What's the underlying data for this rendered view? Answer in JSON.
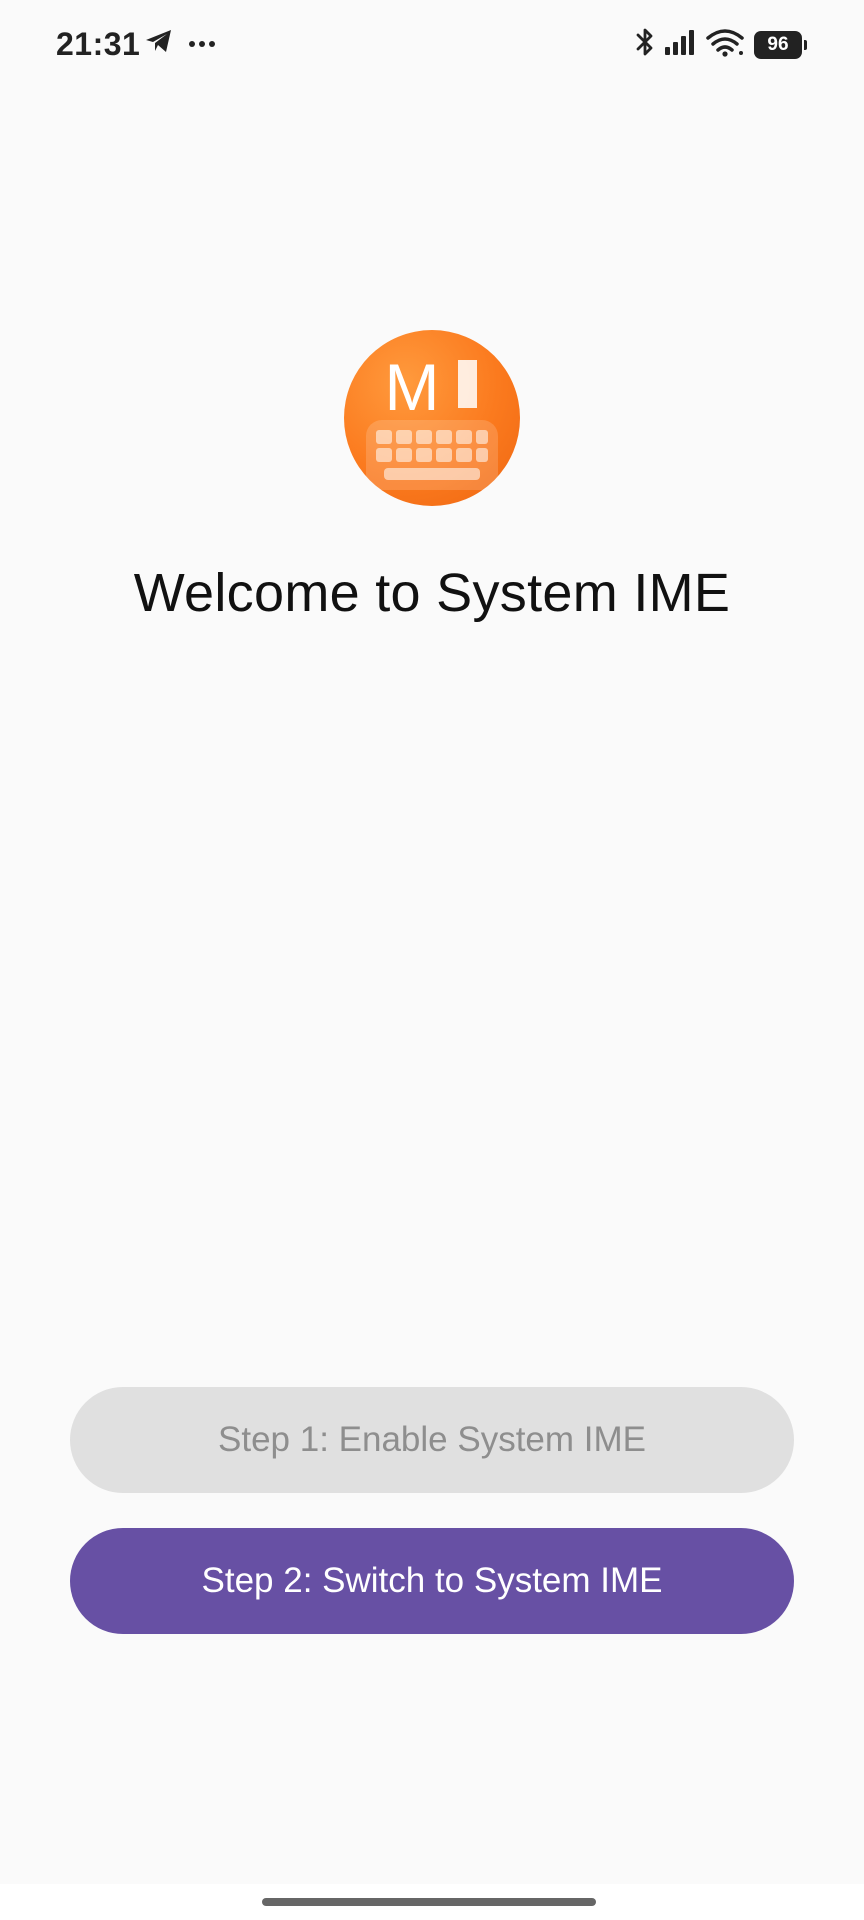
{
  "status_bar": {
    "time": "21:31",
    "battery_level": "96",
    "left_icons": [
      "telegram-icon",
      "more-dots-icon"
    ],
    "right_icons": [
      "bluetooth-icon",
      "signal-icon",
      "wifi-icon",
      "battery-icon"
    ]
  },
  "app": {
    "logo_letter": "M",
    "logo_colors": {
      "primary": "#fb7a1e",
      "highlight": "#ff9a3d"
    },
    "welcome_title": "Welcome to System IME"
  },
  "actions": {
    "step1_label": "Step 1: Enable System IME",
    "step1_enabled": false,
    "step2_label": "Step 2: Switch to System IME",
    "step2_enabled": true
  },
  "colors": {
    "background": "#fafafa",
    "accent": "#6750a4",
    "disabled_button": "#e0e0e0",
    "disabled_text": "#8e8e8e"
  }
}
